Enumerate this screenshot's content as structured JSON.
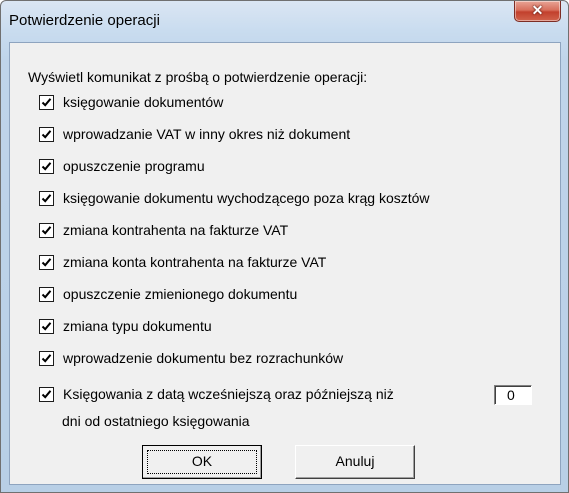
{
  "window": {
    "title": "Potwierdzenie operacji",
    "close_icon": "close-icon"
  },
  "prompt": "Wyświetl komunikat z prośbą o potwierdzenie operacji:",
  "options": [
    {
      "label": "księgowanie dokumentów",
      "checked": true
    },
    {
      "label": "wprowadzanie VAT w inny okres niż dokument",
      "checked": true
    },
    {
      "label": "opuszczenie programu",
      "checked": true
    },
    {
      "label": "księgowanie dokumentu wychodzącego poza krąg kosztów",
      "checked": true
    },
    {
      "label": "zmiana kontrahenta na fakturze VAT",
      "checked": true
    },
    {
      "label": "zmiana konta kontrahenta na fakturze VAT",
      "checked": true
    },
    {
      "label": "opuszczenie zmienionego dokumentu",
      "checked": true
    },
    {
      "label": "zmiana typu dokumentu",
      "checked": true
    },
    {
      "label": "wprowadzenie dokumentu bez rozrachunków",
      "checked": true
    },
    {
      "label": "Księgowania z datą wcześniejszą oraz późniejszą niż",
      "checked": true
    }
  ],
  "days_value": "0",
  "days_suffix": "dni od ostatniego księgowania",
  "buttons": {
    "ok": "OK",
    "cancel": "Anuluj"
  }
}
